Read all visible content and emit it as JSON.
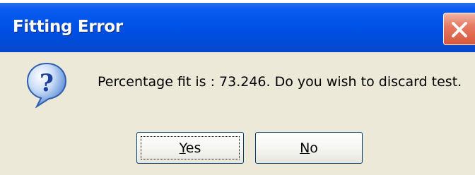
{
  "dialog": {
    "title": "Fitting Error",
    "icon": "question-icon",
    "message": "Percentage fit is : 73.246. Do you wish to discard test.",
    "buttons": [
      {
        "mnemonic": "Y",
        "rest": "es",
        "default": true
      },
      {
        "mnemonic": "N",
        "rest": "o",
        "default": false
      }
    ]
  },
  "colors": {
    "titlebar": "#0052e8",
    "client": "#ece9d8",
    "close": "#d8583a"
  }
}
